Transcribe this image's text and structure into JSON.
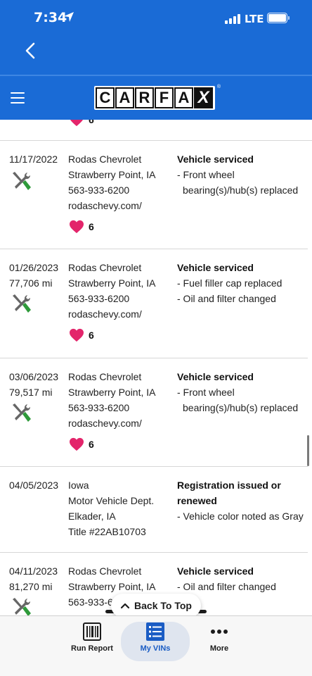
{
  "status_bar": {
    "time": "7:34",
    "network": "LTE"
  },
  "brand": {
    "logo_letters": [
      "C",
      "A",
      "R",
      "F",
      "A",
      "X"
    ],
    "registered": "®"
  },
  "partial_likes": "6",
  "records": [
    {
      "date": "11/17/2022",
      "mileage": "",
      "source": [
        "Rodas Chevrolet",
        "Strawberry Point, IA",
        "563-933-6200",
        "rodaschevy.com/"
      ],
      "title": "Vehicle serviced",
      "items": [
        "- Front wheel bearing(s)/hub(s) replaced"
      ],
      "likes": "6",
      "icon": "wrench-screwdriver-icon"
    },
    {
      "date": "01/26/2023",
      "mileage": "77,706 mi",
      "source": [
        "Rodas Chevrolet",
        "Strawberry Point, IA",
        "563-933-6200",
        "rodaschevy.com/"
      ],
      "title": "Vehicle serviced",
      "items": [
        "- Fuel filler cap replaced",
        "- Oil and filter changed"
      ],
      "likes": "6",
      "icon": "wrench-screwdriver-icon"
    },
    {
      "date": "03/06/2023",
      "mileage": "79,517 mi",
      "source": [
        "Rodas Chevrolet",
        "Strawberry Point, IA",
        "563-933-6200",
        "rodaschevy.com/"
      ],
      "title": "Vehicle serviced",
      "items": [
        "- Front wheel bearing(s)/hub(s) replaced"
      ],
      "likes": "6",
      "icon": "wrench-screwdriver-icon"
    },
    {
      "date": "04/05/2023",
      "mileage": "",
      "source": [
        "Iowa",
        "Motor Vehicle Dept.",
        "Elkader, IA",
        "Title #22AB10703"
      ],
      "title": "Registration issued or renewed",
      "items": [
        "- Vehicle color noted as Gray"
      ],
      "likes": "",
      "icon": ""
    },
    {
      "date": "04/11/2023",
      "mileage": "81,270 mi",
      "source": [
        "Rodas Chevrolet",
        "Strawberry Point, IA",
        "563-933-6200"
      ],
      "title": "Vehicle serviced",
      "items": [
        "- Oil and filter changed"
      ],
      "likes": "",
      "icon": "wrench-screwdriver-icon"
    }
  ],
  "back_to_top": "Back To Top",
  "tabs": [
    {
      "label": "Run Report",
      "icon": "barcode-scan-icon"
    },
    {
      "label": "My VINs",
      "icon": "list-icon",
      "active": true
    },
    {
      "label": "More",
      "icon": "more-dots-icon"
    }
  ],
  "colors": {
    "primary": "#1a6bd6",
    "heart": "#e3256b",
    "tool_green": "#2e9a3a",
    "active_tab": "#1a5cc4"
  }
}
